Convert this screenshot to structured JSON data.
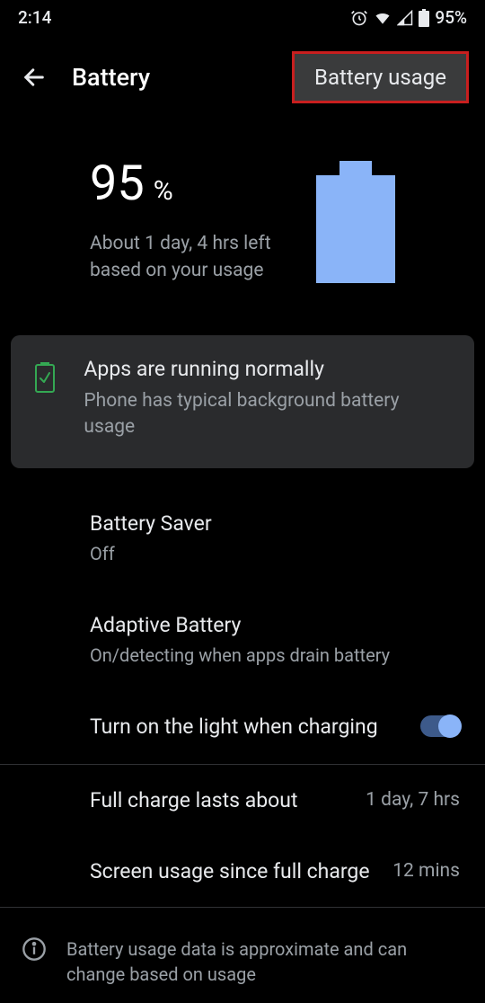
{
  "statusbar": {
    "time": "2:14",
    "battery_pct": "95%"
  },
  "header": {
    "title": "Battery",
    "usage_button": "Battery usage"
  },
  "summary": {
    "percent": "95",
    "percent_symbol": "%",
    "estimate": "About 1 day, 4 hrs left based on your usage"
  },
  "status_card": {
    "title": "Apps are running normally",
    "subtitle": "Phone has typical background battery usage"
  },
  "settings": {
    "saver": {
      "title": "Battery Saver",
      "sub": "Off"
    },
    "adaptive": {
      "title": "Adaptive Battery",
      "sub": "On/detecting when apps drain battery"
    },
    "light": {
      "title": "Turn on the light when charging"
    }
  },
  "stats": {
    "full_charge": {
      "title": "Full charge lasts about",
      "value": "1 day, 7 hrs"
    },
    "screen_usage": {
      "title": "Screen usage since full charge",
      "value": "12 mins"
    }
  },
  "footer": {
    "text": "Battery usage data is approximate and can change based on usage"
  }
}
